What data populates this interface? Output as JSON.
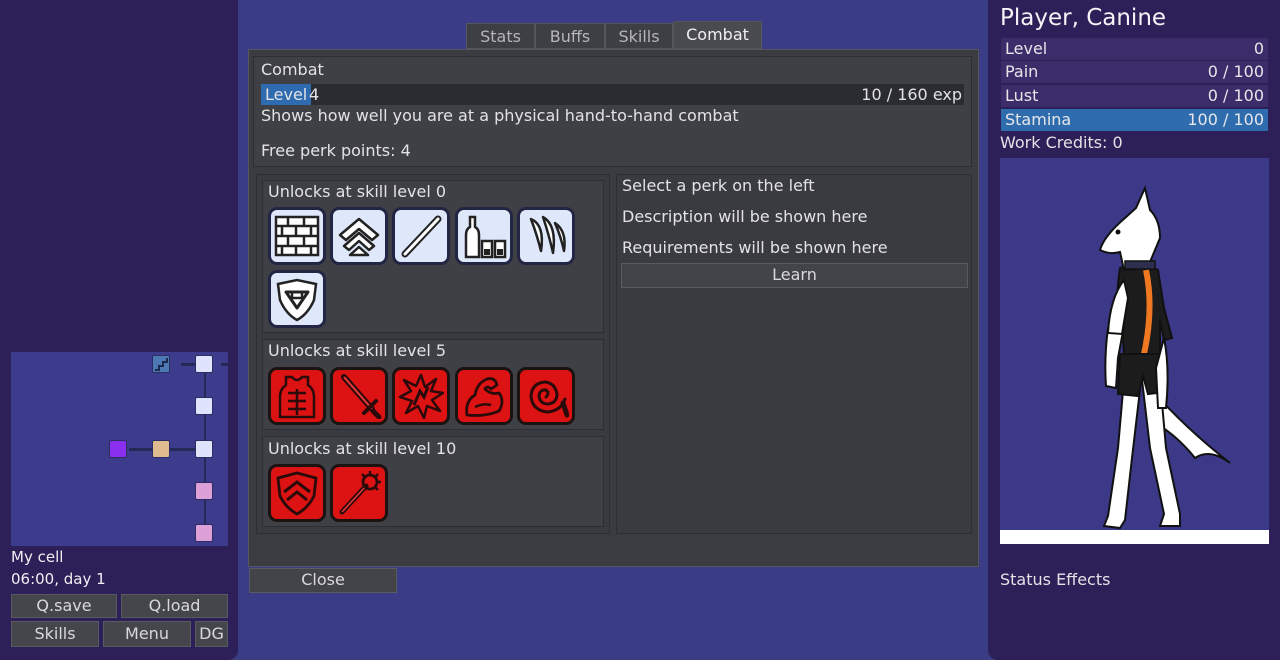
{
  "left_panel": {
    "location": "My cell",
    "time": "06:00, day 1",
    "buttons": {
      "qsave": "Q.save",
      "qload": "Q.load",
      "skills": "Skills",
      "menu": "Menu",
      "dg": "DG"
    }
  },
  "tabs": [
    "Stats",
    "Buffs",
    "Skills",
    "Combat"
  ],
  "active_tab": "Combat",
  "skill": {
    "name": "Combat",
    "level_label": "Level",
    "level": "4",
    "exp_text": "10 / 160 exp",
    "exp_current": 10,
    "exp_needed": 160,
    "description": "Shows how well you are at a physical hand-to-hand combat",
    "free_points": "Free perk points: 4"
  },
  "perk_groups": [
    {
      "title": "Unlocks at skill level 0",
      "icons": [
        "brick-wall-icon",
        "rank-chevrons-icon",
        "staff-icon",
        "bottles-icon",
        "claws-icon",
        "shield-icon"
      ]
    },
    {
      "title": "Unlocks at skill level 5",
      "icons": [
        "vest-icon",
        "sword-icon",
        "impact-icon",
        "muscle-arm-icon",
        "whip-icon"
      ]
    },
    {
      "title": "Unlocks at skill level 10",
      "icons": [
        "shield-chevrons-icon",
        "mace-icon"
      ]
    }
  ],
  "perk_detail": {
    "select_hint": "Select a perk on the left",
    "description": "Description will be shown here",
    "requirements": "Requirements will be shown here",
    "learn_label": "Learn"
  },
  "close_label": "Close",
  "player": {
    "name": "Player, Canine",
    "stats": [
      {
        "label": "Level",
        "value": "0",
        "fill": 0
      },
      {
        "label": "Pain",
        "value": "0 / 100",
        "fill": 0
      },
      {
        "label": "Lust",
        "value": "0 / 100",
        "fill": 0
      },
      {
        "label": "Stamina",
        "value": "100 / 100",
        "fill": 1
      }
    ],
    "work_credits": "Work Credits: 0",
    "status_effects": "Status Effects"
  },
  "colors": {
    "accent": "#2f6cae",
    "background": "#3b3c86",
    "panel": "#2d1f57",
    "perk_red": "#dd1212",
    "perk_white": "#dfe8fb"
  }
}
